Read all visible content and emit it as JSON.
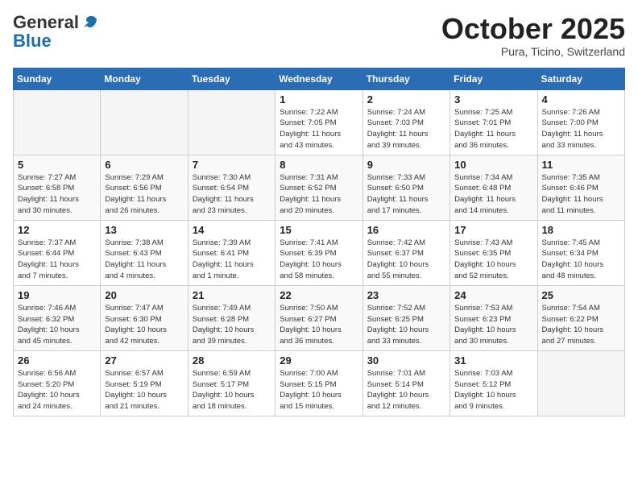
{
  "header": {
    "logo_general": "General",
    "logo_blue": "Blue",
    "month": "October 2025",
    "location": "Pura, Ticino, Switzerland"
  },
  "days_of_week": [
    "Sunday",
    "Monday",
    "Tuesday",
    "Wednesday",
    "Thursday",
    "Friday",
    "Saturday"
  ],
  "weeks": [
    [
      {
        "day": "",
        "info": ""
      },
      {
        "day": "",
        "info": ""
      },
      {
        "day": "",
        "info": ""
      },
      {
        "day": "1",
        "info": "Sunrise: 7:22 AM\nSunset: 7:05 PM\nDaylight: 11 hours\nand 43 minutes."
      },
      {
        "day": "2",
        "info": "Sunrise: 7:24 AM\nSunset: 7:03 PM\nDaylight: 11 hours\nand 39 minutes."
      },
      {
        "day": "3",
        "info": "Sunrise: 7:25 AM\nSunset: 7:01 PM\nDaylight: 11 hours\nand 36 minutes."
      },
      {
        "day": "4",
        "info": "Sunrise: 7:26 AM\nSunset: 7:00 PM\nDaylight: 11 hours\nand 33 minutes."
      }
    ],
    [
      {
        "day": "5",
        "info": "Sunrise: 7:27 AM\nSunset: 6:58 PM\nDaylight: 11 hours\nand 30 minutes."
      },
      {
        "day": "6",
        "info": "Sunrise: 7:29 AM\nSunset: 6:56 PM\nDaylight: 11 hours\nand 26 minutes."
      },
      {
        "day": "7",
        "info": "Sunrise: 7:30 AM\nSunset: 6:54 PM\nDaylight: 11 hours\nand 23 minutes."
      },
      {
        "day": "8",
        "info": "Sunrise: 7:31 AM\nSunset: 6:52 PM\nDaylight: 11 hours\nand 20 minutes."
      },
      {
        "day": "9",
        "info": "Sunrise: 7:33 AM\nSunset: 6:50 PM\nDaylight: 11 hours\nand 17 minutes."
      },
      {
        "day": "10",
        "info": "Sunrise: 7:34 AM\nSunset: 6:48 PM\nDaylight: 11 hours\nand 14 minutes."
      },
      {
        "day": "11",
        "info": "Sunrise: 7:35 AM\nSunset: 6:46 PM\nDaylight: 11 hours\nand 11 minutes."
      }
    ],
    [
      {
        "day": "12",
        "info": "Sunrise: 7:37 AM\nSunset: 6:44 PM\nDaylight: 11 hours\nand 7 minutes."
      },
      {
        "day": "13",
        "info": "Sunrise: 7:38 AM\nSunset: 6:43 PM\nDaylight: 11 hours\nand 4 minutes."
      },
      {
        "day": "14",
        "info": "Sunrise: 7:39 AM\nSunset: 6:41 PM\nDaylight: 11 hours\nand 1 minute."
      },
      {
        "day": "15",
        "info": "Sunrise: 7:41 AM\nSunset: 6:39 PM\nDaylight: 10 hours\nand 58 minutes."
      },
      {
        "day": "16",
        "info": "Sunrise: 7:42 AM\nSunset: 6:37 PM\nDaylight: 10 hours\nand 55 minutes."
      },
      {
        "day": "17",
        "info": "Sunrise: 7:43 AM\nSunset: 6:35 PM\nDaylight: 10 hours\nand 52 minutes."
      },
      {
        "day": "18",
        "info": "Sunrise: 7:45 AM\nSunset: 6:34 PM\nDaylight: 10 hours\nand 48 minutes."
      }
    ],
    [
      {
        "day": "19",
        "info": "Sunrise: 7:46 AM\nSunset: 6:32 PM\nDaylight: 10 hours\nand 45 minutes."
      },
      {
        "day": "20",
        "info": "Sunrise: 7:47 AM\nSunset: 6:30 PM\nDaylight: 10 hours\nand 42 minutes."
      },
      {
        "day": "21",
        "info": "Sunrise: 7:49 AM\nSunset: 6:28 PM\nDaylight: 10 hours\nand 39 minutes."
      },
      {
        "day": "22",
        "info": "Sunrise: 7:50 AM\nSunset: 6:27 PM\nDaylight: 10 hours\nand 36 minutes."
      },
      {
        "day": "23",
        "info": "Sunrise: 7:52 AM\nSunset: 6:25 PM\nDaylight: 10 hours\nand 33 minutes."
      },
      {
        "day": "24",
        "info": "Sunrise: 7:53 AM\nSunset: 6:23 PM\nDaylight: 10 hours\nand 30 minutes."
      },
      {
        "day": "25",
        "info": "Sunrise: 7:54 AM\nSunset: 6:22 PM\nDaylight: 10 hours\nand 27 minutes."
      }
    ],
    [
      {
        "day": "26",
        "info": "Sunrise: 6:56 AM\nSunset: 5:20 PM\nDaylight: 10 hours\nand 24 minutes."
      },
      {
        "day": "27",
        "info": "Sunrise: 6:57 AM\nSunset: 5:19 PM\nDaylight: 10 hours\nand 21 minutes."
      },
      {
        "day": "28",
        "info": "Sunrise: 6:59 AM\nSunset: 5:17 PM\nDaylight: 10 hours\nand 18 minutes."
      },
      {
        "day": "29",
        "info": "Sunrise: 7:00 AM\nSunset: 5:15 PM\nDaylight: 10 hours\nand 15 minutes."
      },
      {
        "day": "30",
        "info": "Sunrise: 7:01 AM\nSunset: 5:14 PM\nDaylight: 10 hours\nand 12 minutes."
      },
      {
        "day": "31",
        "info": "Sunrise: 7:03 AM\nSunset: 5:12 PM\nDaylight: 10 hours\nand 9 minutes."
      },
      {
        "day": "",
        "info": ""
      }
    ]
  ]
}
